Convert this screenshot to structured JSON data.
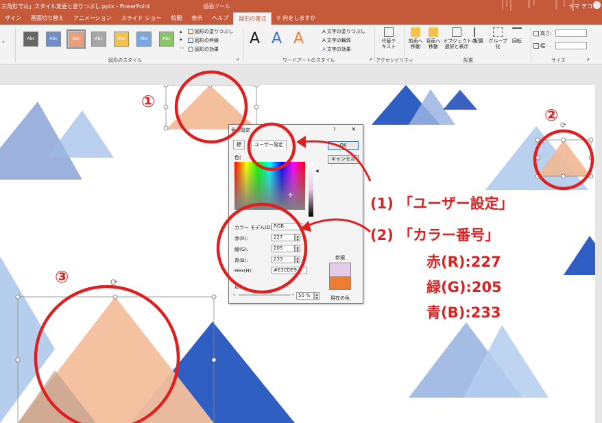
{
  "window": {
    "doc_title": "三角形で山」スタイル変更と塗りつぶし.pptx - PowerPoint",
    "contextual_tab_title": "描画ツール",
    "user": "ケマ チコ"
  },
  "tabs": [
    "ザイン",
    "画面切り替え",
    "アニメーション",
    "スライド ショー",
    "校閲",
    "表示",
    "ヘルプ",
    "図形の書式",
    "何をしますか"
  ],
  "ribbon": {
    "shape_styles": {
      "swatch_text": "Abc",
      "swatch_colors": [
        "#666666",
        "#6f8fc8",
        "#ed9f7a",
        "#a6a6a6",
        "#f2c14e",
        "#7aa7df",
        "#8cc36a"
      ],
      "fill": "図形の塗りつぶし",
      "outline": "図形の枠線",
      "effects": "図形の効果",
      "group_label": "図形のスタイル"
    },
    "wordart": {
      "letters": [
        "A",
        "A",
        "A"
      ],
      "letter_colors": [
        "#111111",
        "#3a6fd8",
        "#ed7d31"
      ],
      "text_fill": "文字の塗りつぶし",
      "text_outline": "文字の輪郭",
      "text_effects": "文字の効果",
      "group_label": "ワードアートのスタイル"
    },
    "accessibility": {
      "alt_text": "代替テ\nキスト",
      "group_label": "アクセシビリティ"
    },
    "arrange": {
      "bring_forward": "前面へ\n移動",
      "send_backward": "背面へ\n移動",
      "selection_pane": "オブジェクトの\n選択と表示",
      "align": "配置",
      "group": "グループ化",
      "rotate": "回転",
      "group_label": "配置"
    },
    "size": {
      "height_label": "高さ:",
      "width_label": "幅:",
      "group_label": "サイズ"
    }
  },
  "dialog": {
    "title": "色の設定",
    "help": "?",
    "close": "×",
    "tab_standard": "標",
    "tab_custom": "ユーザー設定",
    "ok": "OK",
    "cancel": "キャンセル",
    "colors_label": "色(",
    "color_model_label": "カラー モデル(D):",
    "color_model_value": "RGB",
    "red_label": "赤(R):",
    "red_value": "227",
    "green_label": "緑(G):",
    "green_value": "205",
    "blue_label": "青(B):",
    "blue_value": "233",
    "hex_label": "Hex(H):",
    "hex_value": "#E3CDE9",
    "transparency_label": "透(",
    "transparency_value": "50 %",
    "new_label": "新規",
    "current_label": "現在の色",
    "new_color": "#e3cde9",
    "current_color": "#ed7d31"
  },
  "annotations": {
    "marker_1": "①",
    "marker_2": "②",
    "marker_3": "③",
    "step1": "(1) 「ユーザー設定」",
    "step2": "(2) 「カラー番号」",
    "r": "赤(R):227",
    "g": "緑(G):205",
    "b": "青(B):233",
    "color": "#e02020"
  }
}
